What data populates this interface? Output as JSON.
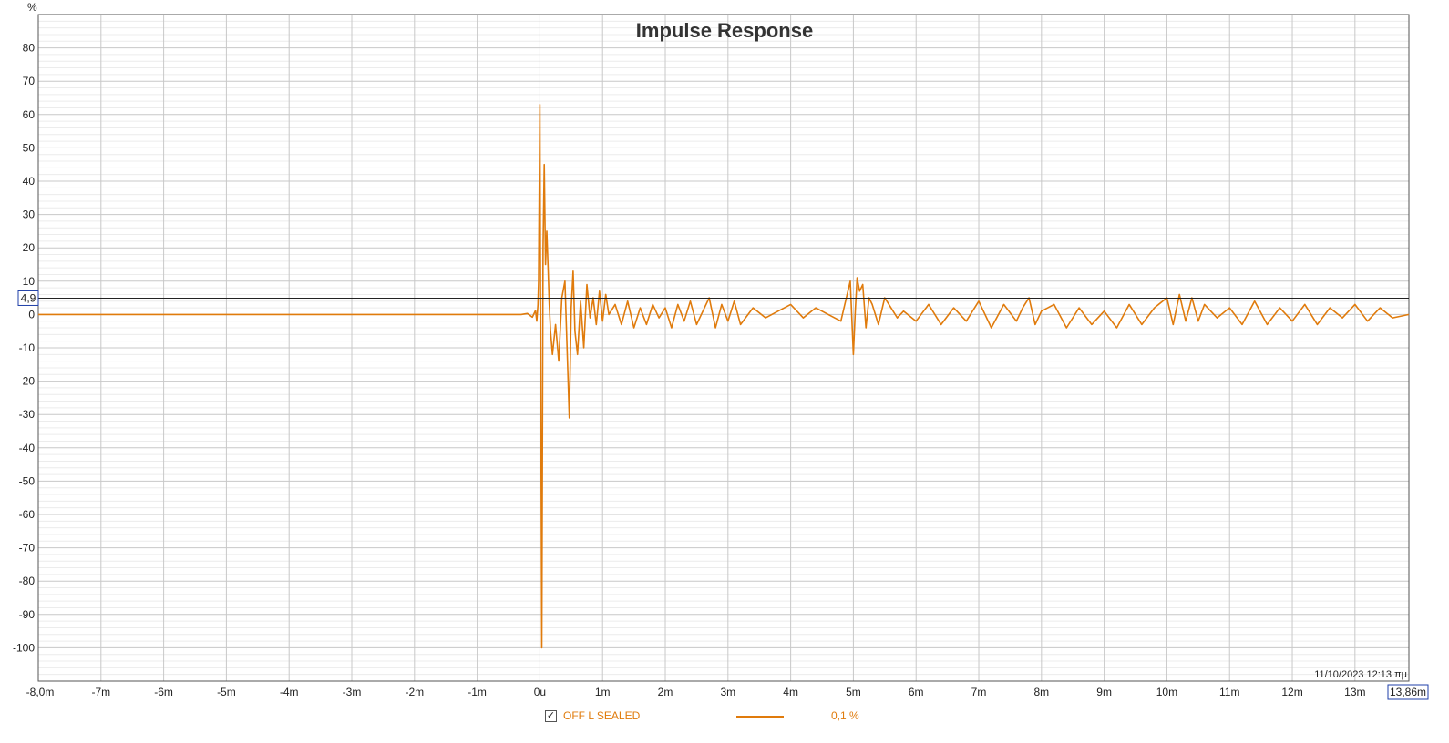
{
  "chart_data": {
    "type": "line",
    "title": "Impulse Response",
    "y_unit_label": "%",
    "ylim": [
      -110,
      90
    ],
    "y_ticks": [
      80,
      70,
      60,
      50,
      40,
      30,
      20,
      10,
      0,
      -10,
      -20,
      -30,
      -40,
      -50,
      -60,
      -70,
      -80,
      -90,
      -100
    ],
    "xlim": [
      -8.0,
      13.86
    ],
    "x_ticks": [
      {
        "v": -8,
        "label": "-8,0m"
      },
      {
        "v": -7,
        "label": "-7m"
      },
      {
        "v": -6,
        "label": "-6m"
      },
      {
        "v": -5,
        "label": "-5m"
      },
      {
        "v": -4,
        "label": "-4m"
      },
      {
        "v": -3,
        "label": "-3m"
      },
      {
        "v": -2,
        "label": "-2m"
      },
      {
        "v": -1,
        "label": "-1m"
      },
      {
        "v": 0,
        "label": "0u"
      },
      {
        "v": 1,
        "label": "1m"
      },
      {
        "v": 2,
        "label": "2m"
      },
      {
        "v": 3,
        "label": "3m"
      },
      {
        "v": 4,
        "label": "4m"
      },
      {
        "v": 5,
        "label": "5m"
      },
      {
        "v": 6,
        "label": "6m"
      },
      {
        "v": 7,
        "label": "7m"
      },
      {
        "v": 8,
        "label": "8m"
      },
      {
        "v": 9,
        "label": "9m"
      },
      {
        "v": 10,
        "label": "10m"
      },
      {
        "v": 11,
        "label": "11m"
      },
      {
        "v": 12,
        "label": "12m"
      },
      {
        "v": 13,
        "label": "13m"
      }
    ],
    "x_end_label": "13,86m",
    "cursor_y": 4.9,
    "cursor_y_label": "4,9",
    "timestamp": "11/10/2023 12:13 πμ",
    "grid": true,
    "series": [
      {
        "name": "OFF L SEALED",
        "color": "#e07b0c",
        "x": [
          -8.0,
          -1.0,
          -0.3,
          -0.2,
          -0.12,
          -0.07,
          -0.05,
          -0.03,
          -0.02,
          0.0,
          0.01,
          0.03,
          0.05,
          0.07,
          0.09,
          0.11,
          0.13,
          0.15,
          0.17,
          0.2,
          0.25,
          0.3,
          0.35,
          0.4,
          0.43,
          0.47,
          0.5,
          0.53,
          0.56,
          0.6,
          0.65,
          0.7,
          0.75,
          0.8,
          0.85,
          0.9,
          0.95,
          1.0,
          1.05,
          1.1,
          1.2,
          1.3,
          1.4,
          1.5,
          1.6,
          1.7,
          1.8,
          1.9,
          2.0,
          2.1,
          2.2,
          2.3,
          2.4,
          2.5,
          2.6,
          2.7,
          2.8,
          2.9,
          3.0,
          3.1,
          3.2,
          3.4,
          3.6,
          3.8,
          4.0,
          4.2,
          4.4,
          4.6,
          4.8,
          4.95,
          5.0,
          5.03,
          5.06,
          5.1,
          5.15,
          5.2,
          5.25,
          5.3,
          5.4,
          5.5,
          5.6,
          5.7,
          5.8,
          6.0,
          6.2,
          6.4,
          6.6,
          6.8,
          7.0,
          7.2,
          7.4,
          7.6,
          7.7,
          7.8,
          7.9,
          8.0,
          8.2,
          8.4,
          8.6,
          8.8,
          9.0,
          9.2,
          9.4,
          9.6,
          9.8,
          10.0,
          10.1,
          10.2,
          10.3,
          10.4,
          10.5,
          10.6,
          10.8,
          11.0,
          11.2,
          11.4,
          11.6,
          11.8,
          12.0,
          12.2,
          12.4,
          12.6,
          12.8,
          13.0,
          13.2,
          13.4,
          13.6,
          13.86
        ],
        "y": [
          0,
          0,
          0,
          0.3,
          -0.8,
          1.2,
          -2,
          3,
          10,
          63,
          5,
          -100,
          20,
          45,
          15,
          25,
          14,
          3,
          -5,
          -12,
          -3,
          -14,
          5,
          10,
          -8,
          -31,
          2,
          13,
          -5,
          -12,
          4,
          -10,
          9,
          -1,
          5,
          -3,
          7,
          -2,
          6,
          0,
          3,
          -3,
          4,
          -4,
          2,
          -3,
          3,
          -1,
          2,
          -4,
          3,
          -2,
          4,
          -3,
          1,
          5,
          -4,
          3,
          -2,
          4,
          -3,
          2,
          -1,
          1,
          3,
          -1,
          2,
          0,
          -2,
          10,
          -12,
          1,
          11,
          7,
          9,
          -4,
          5,
          3,
          -3,
          5,
          2,
          -1,
          1,
          -2,
          3,
          -3,
          2,
          -2,
          4,
          -4,
          3,
          -2,
          2,
          5,
          -3,
          1,
          3,
          -4,
          2,
          -3,
          1,
          -4,
          3,
          -3,
          2,
          5,
          -3,
          6,
          -2,
          5,
          -2,
          3,
          -1,
          2,
          -3,
          4,
          -3,
          2,
          -2,
          3,
          -3,
          2,
          -1,
          3,
          -2,
          2,
          -1,
          0
        ]
      }
    ]
  },
  "legend": {
    "series_name": "OFF L SEALED",
    "checked_glyph": "✓",
    "smoothing_label": "0,1 %"
  }
}
